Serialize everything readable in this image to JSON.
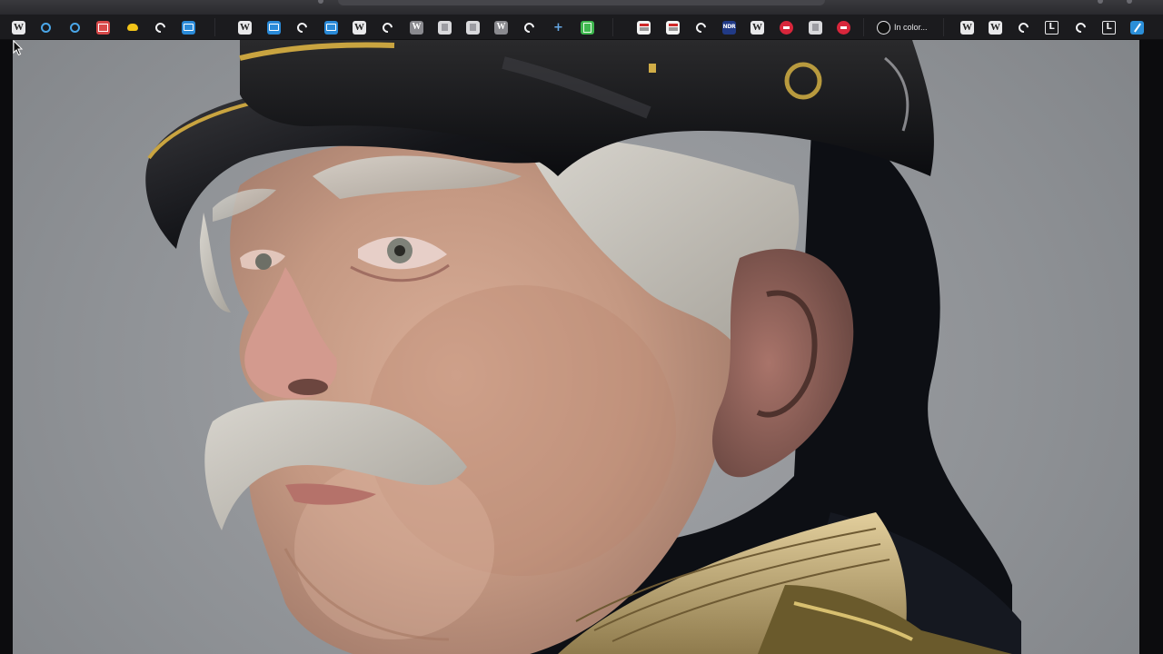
{
  "bookmarks_bar": {
    "items": [
      {
        "icon": "wikipedia-icon",
        "style": "w",
        "glyph": "W"
      },
      {
        "icon": "clock-icon",
        "style": "clock",
        "glyph": ""
      },
      {
        "icon": "clock-icon",
        "style": "clock",
        "glyph": ""
      },
      {
        "icon": "image-icon",
        "style": "redbox",
        "glyph": ""
      },
      {
        "icon": "chat-bubble-icon",
        "style": "yellow",
        "glyph": ""
      },
      {
        "icon": "openai-icon",
        "style": "ring",
        "glyph": ""
      },
      {
        "icon": "window-icon",
        "style": "blue",
        "glyph": ""
      },
      {
        "icon": "wikipedia-icon",
        "style": "w",
        "glyph": "W"
      },
      {
        "icon": "window-icon",
        "style": "blue",
        "glyph": ""
      },
      {
        "icon": "openai-icon",
        "style": "ring",
        "glyph": ""
      },
      {
        "icon": "window-icon",
        "style": "blue",
        "glyph": ""
      },
      {
        "icon": "wikipedia-icon",
        "style": "w",
        "glyph": "W"
      },
      {
        "icon": "openai-icon",
        "style": "ring",
        "glyph": ""
      },
      {
        "icon": "wikipedia-icon",
        "style": "grey",
        "glyph": "W"
      },
      {
        "icon": "document-icon",
        "style": "pale",
        "glyph": ""
      },
      {
        "icon": "document-icon",
        "style": "pale",
        "glyph": ""
      },
      {
        "icon": "wikipedia-icon",
        "style": "grey",
        "glyph": "W"
      },
      {
        "icon": "openai-icon",
        "style": "ring",
        "glyph": ""
      },
      {
        "icon": "plus-icon",
        "style": "plus",
        "glyph": "+"
      },
      {
        "icon": "sheet-icon",
        "style": "green",
        "glyph": ""
      },
      {
        "icon": "news-icon",
        "style": "news",
        "glyph": ""
      },
      {
        "icon": "news-icon",
        "style": "news",
        "glyph": ""
      },
      {
        "icon": "openai-icon",
        "style": "ring",
        "glyph": ""
      },
      {
        "icon": "ndr-icon",
        "style": "navy",
        "glyph": "NDR"
      },
      {
        "icon": "wikipedia-icon",
        "style": "w",
        "glyph": "W"
      },
      {
        "icon": "record-icon",
        "style": "redball",
        "glyph": ""
      },
      {
        "icon": "document-icon",
        "style": "pale",
        "glyph": ""
      },
      {
        "icon": "record-icon",
        "style": "redball",
        "glyph": ""
      },
      {
        "icon": "avatar-icon",
        "style": "avatar",
        "glyph": "",
        "label": "In color..."
      },
      {
        "icon": "wikipedia-icon",
        "style": "w",
        "glyph": "W"
      },
      {
        "icon": "wikipedia-icon",
        "style": "w",
        "glyph": "W"
      },
      {
        "icon": "openai-icon",
        "style": "ring",
        "glyph": ""
      },
      {
        "icon": "letter-l-icon",
        "style": "lbox",
        "glyph": "L"
      },
      {
        "icon": "openai-icon",
        "style": "ring",
        "glyph": ""
      },
      {
        "icon": "letter-l-icon",
        "style": "lbox",
        "glyph": "L"
      },
      {
        "icon": "pen-icon",
        "style": "slash",
        "glyph": ""
      }
    ]
  },
  "content": {
    "image": "colorized-portrait",
    "description_colors": {
      "background": "#9a9ca0",
      "cap": "#14161a",
      "skin": "#c99c86",
      "hair": "#c8c4bd",
      "collar": "#cdb98a"
    }
  },
  "cursor": {
    "icon": "mouse-pointer-icon"
  }
}
